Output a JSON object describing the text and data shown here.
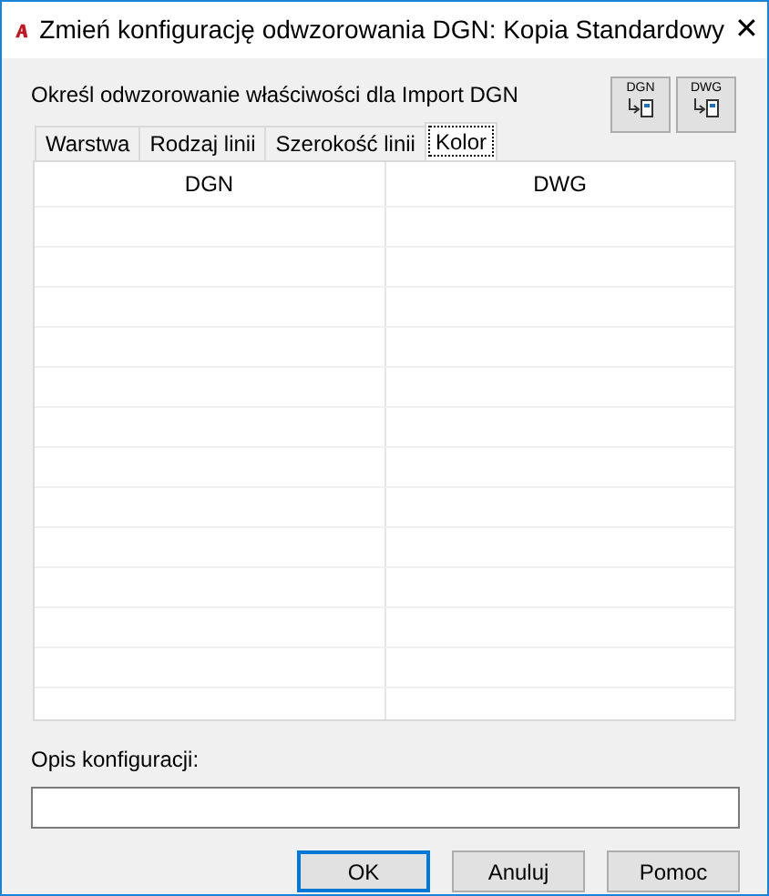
{
  "window": {
    "title": "Zmień konfigurację odwzorowania DGN: Kopia Standardowy",
    "close": "✕"
  },
  "prompt": "Określ odwzorowanie właściwości dla Import DGN",
  "tool_buttons": [
    {
      "label": "DGN"
    },
    {
      "label": "DWG"
    }
  ],
  "tabs": [
    {
      "label": "Warstwa",
      "selected": false
    },
    {
      "label": "Rodzaj linii",
      "selected": false
    },
    {
      "label": "Szerokość linii",
      "selected": false
    },
    {
      "label": "Kolor",
      "selected": true
    }
  ],
  "table": {
    "columns": [
      "DGN",
      "DWG"
    ]
  },
  "description": {
    "label": "Opis konfiguracji:"
  },
  "buttons": [
    {
      "label": "OK",
      "default": true
    },
    {
      "label": "Anuluj",
      "default": false
    },
    {
      "label": "Pomoc",
      "default": false
    }
  ]
}
